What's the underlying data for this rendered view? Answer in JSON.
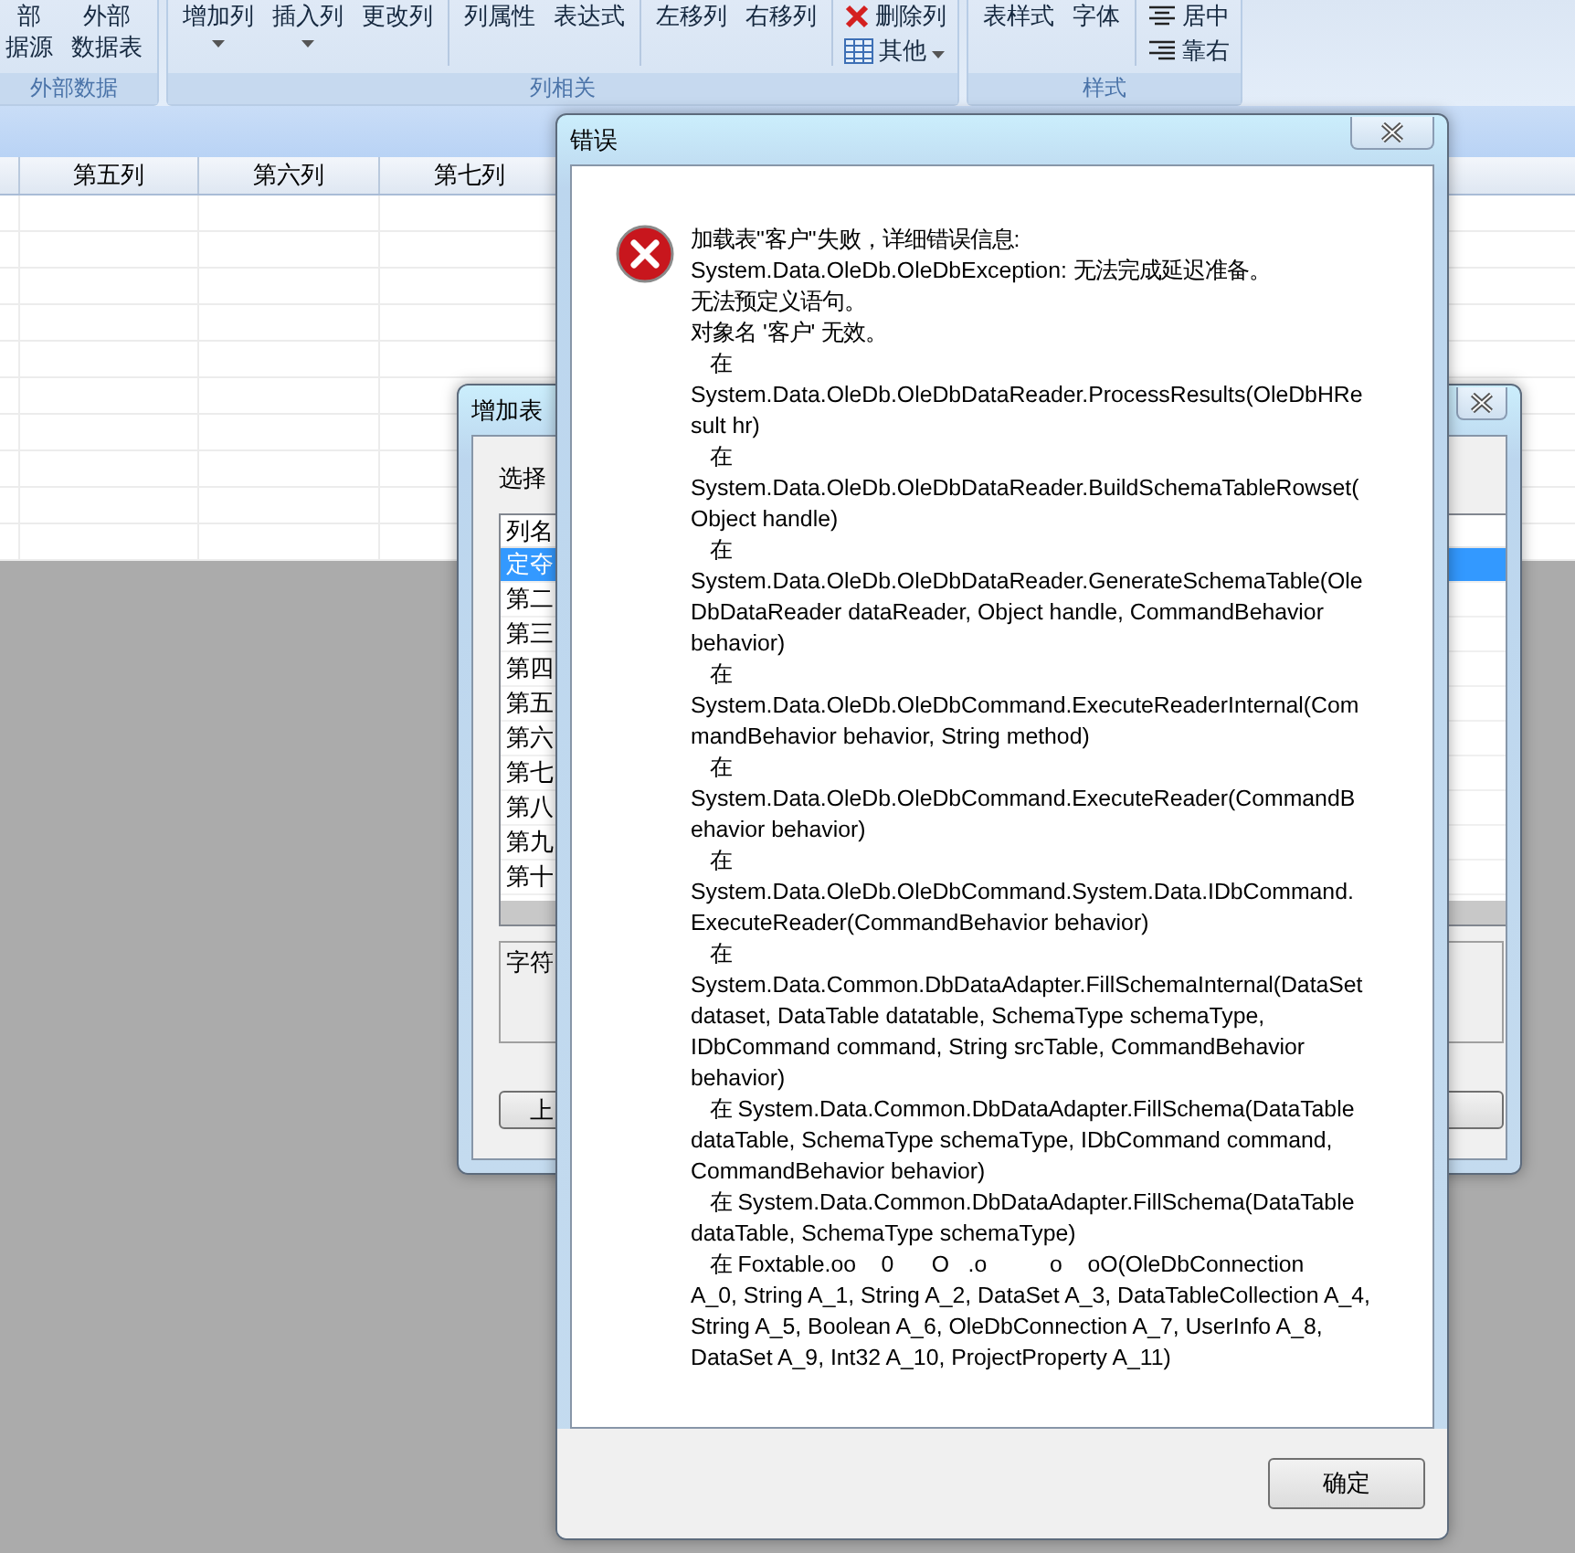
{
  "ribbon": {
    "groups": [
      {
        "label": "外部数据",
        "buttons": [
          {
            "kind": "large",
            "lines": [
              "部",
              "据源"
            ],
            "dropdown": false
          },
          {
            "kind": "large",
            "lines": [
              "外部",
              "数据表"
            ],
            "dropdown": false
          }
        ]
      },
      {
        "label": "列相关",
        "buttons": [
          {
            "kind": "large",
            "lines": [
              "增加列"
            ],
            "dropdown": true
          },
          {
            "kind": "large",
            "lines": [
              "插入列"
            ],
            "dropdown": true
          },
          {
            "kind": "large",
            "lines": [
              "更改列"
            ],
            "dropdown": false
          },
          {
            "kind": "separator"
          },
          {
            "kind": "large",
            "lines": [
              "列属性"
            ],
            "dropdown": false
          },
          {
            "kind": "large",
            "lines": [
              "表达式"
            ],
            "dropdown": false
          },
          {
            "kind": "separator"
          },
          {
            "kind": "large",
            "lines": [
              "左移列"
            ],
            "dropdown": false
          },
          {
            "kind": "large",
            "lines": [
              "右移列"
            ],
            "dropdown": false
          },
          {
            "kind": "separator"
          },
          {
            "kind": "stack",
            "items": [
              {
                "label": "删除列",
                "dropdown": false
              },
              {
                "label": "其他",
                "dropdown": true
              }
            ]
          }
        ]
      },
      {
        "label": "样式",
        "buttons": [
          {
            "kind": "large",
            "lines": [
              "表样式"
            ],
            "dropdown": false
          },
          {
            "kind": "large",
            "lines": [
              "字体"
            ],
            "dropdown": false
          },
          {
            "kind": "separator"
          },
          {
            "kind": "stack",
            "items": [
              {
                "label": "居中",
                "dropdown": false
              },
              {
                "label": "靠右",
                "dropdown": false
              }
            ]
          }
        ]
      }
    ]
  },
  "grid": {
    "columns": [
      "第五列",
      "第六列",
      "第七列"
    ]
  },
  "add_table_dialog": {
    "title": "增加表",
    "prompt": "选择",
    "list": {
      "header": "列名",
      "items": [
        {
          "label": "定夺",
          "selected": true
        },
        {
          "label": "第二",
          "selected": false
        },
        {
          "label": "第三",
          "selected": false
        },
        {
          "label": "第四",
          "selected": false
        },
        {
          "label": "第五",
          "selected": false
        },
        {
          "label": "第六",
          "selected": false
        },
        {
          "label": "第七",
          "selected": false
        },
        {
          "label": "第八",
          "selected": false
        },
        {
          "label": "第九",
          "selected": false
        },
        {
          "label": "第十",
          "selected": false
        }
      ]
    },
    "type_label": "字符",
    "button": "上"
  },
  "error_dialog": {
    "title": "错误",
    "lines": [
      "加载表\"客户\"失败，详细错误信息:",
      "System.Data.OleDb.OleDbException: 无法完成延迟准备。",
      "无法预定义语句。",
      "对象名 '客户' 无效。",
      "   在",
      "System.Data.OleDb.OleDbDataReader.ProcessResults(OleDbHRe",
      "sult hr)",
      "   在",
      "System.Data.OleDb.OleDbDataReader.BuildSchemaTableRowset(",
      "Object handle)",
      "   在",
      "System.Data.OleDb.OleDbDataReader.GenerateSchemaTable(Ole",
      "DbDataReader dataReader, Object handle, CommandBehavior",
      "behavior)",
      "   在",
      "System.Data.OleDb.OleDbCommand.ExecuteReaderInternal(Com",
      "mandBehavior behavior, String method)",
      "   在",
      "System.Data.OleDb.OleDbCommand.ExecuteReader(CommandB",
      "ehavior behavior)",
      "   在",
      "System.Data.OleDb.OleDbCommand.System.Data.IDbCommand.",
      "ExecuteReader(CommandBehavior behavior)",
      "   在",
      "System.Data.Common.DbDataAdapter.FillSchemaInternal(DataSet",
      "dataset, DataTable datatable, SchemaType schemaType,",
      "IDbCommand command, String srcTable, CommandBehavior",
      "behavior)",
      "   在 System.Data.Common.DbDataAdapter.FillSchema(DataTable",
      "dataTable, SchemaType schemaType, IDbCommand command,",
      "CommandBehavior behavior)",
      "   在 System.Data.Common.DbDataAdapter.FillSchema(DataTable",
      "dataTable, SchemaType schemaType)",
      "   在 Foxtable.oo    0      O   .o          o    oO(OleDbConnection",
      "A_0, String A_1, String A_2, DataSet A_3, DataTableCollection A_4,",
      "String A_5, Boolean A_6, OleDbConnection A_7, UserInfo A_8,",
      "DataSet A_9, Int32 A_10, ProjectProperty A_11)"
    ],
    "ok_button": "确定"
  }
}
